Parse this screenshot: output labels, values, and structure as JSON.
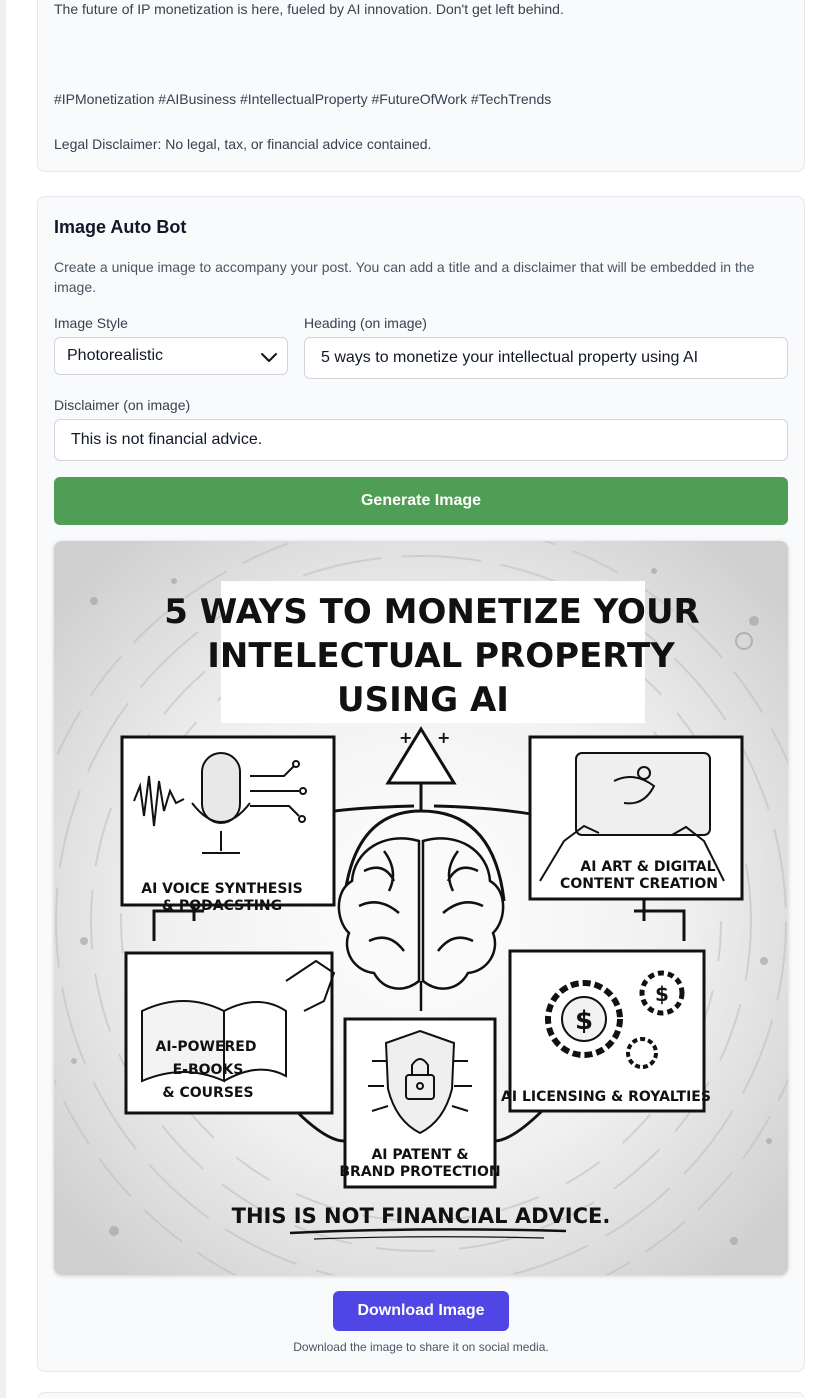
{
  "post": {
    "line1": "The future of IP monetization is here, fueled by AI innovation. Don't get left behind.",
    "hashtags": "#IPMonetization #AIBusiness #IntellectualProperty #FutureOfWork #TechTrends",
    "legal": "Legal Disclaimer: No legal, tax, or financial advice contained."
  },
  "image_bot": {
    "title": "Image Auto Bot",
    "description": "Create a unique image to accompany your post. You can add a title and a disclaimer that will be embedded in the image.",
    "style_label": "Image Style",
    "style_value": "Photorealistic",
    "heading_label": "Heading (on image)",
    "heading_value": "5 ways to monetize your intellectual property using AI",
    "disclaimer_label": "Disclaimer (on image)",
    "disclaimer_value": "This is not financial advice.",
    "generate_button": "Generate Image",
    "download_button": "Download Image",
    "download_note": "Download the image to share it on social media."
  },
  "generated_image": {
    "title_line1": "5 WAYS TO MONETIZE YOUR",
    "title_line2": "INTELECTUAL PROPERTY",
    "title_line3": "USING AI",
    "panel1_line1": "AI VOICE SYNTHESIS",
    "panel1_line2": "& PODACSTING",
    "panel2_line1": "AI ART & DIGITAL",
    "panel2_line2": "CONTENT CREATION",
    "panel3_line1": "AI-POWERED",
    "panel3_line2": "E-BOOKS",
    "panel3_line3": "& COURSES",
    "panel4_line1": "AI LICENSING & ROYALTIES",
    "panel5_line1": "AI PATENT &",
    "panel5_line2": "BRAND PROTECTION",
    "disclaimer": "THIS IS NOT FINANCIAL ADVICE."
  },
  "colors": {
    "generate": "#4f9e55",
    "download": "#4f46e5"
  },
  "icons": [
    "chevron-down-icon",
    "microphone-icon",
    "brain-icon",
    "robot-hand-icon",
    "book-icon",
    "shield-lock-icon",
    "gear-dollar-icon",
    "triangle-icon"
  ]
}
